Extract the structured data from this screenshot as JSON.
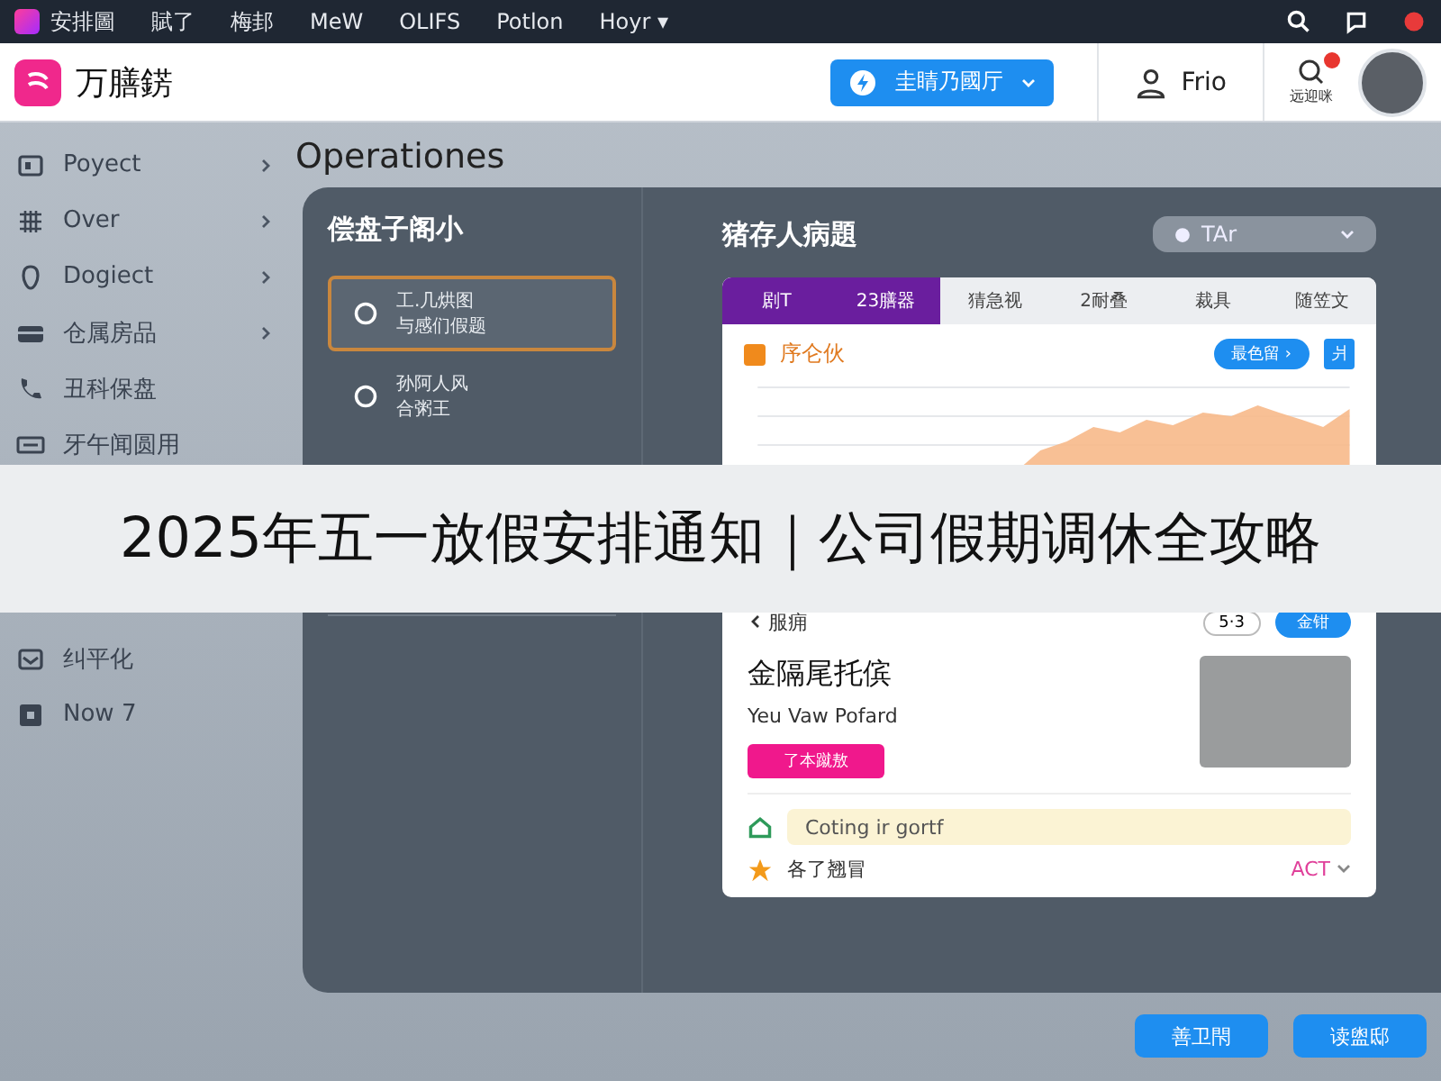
{
  "top_bar": {
    "brand": "安排圖",
    "menu": [
      "賦了",
      "梅邽",
      "MeW",
      "OLIFS",
      "Potlon",
      "Hoyr ▾"
    ]
  },
  "header": {
    "app_name": "万膳錺",
    "primary_button": "圭睛乃國厅",
    "user_label": "Frio",
    "notify_label": "远迎咪"
  },
  "sidebar": {
    "items": [
      {
        "label": "Poyect",
        "chevron": true
      },
      {
        "label": "Over",
        "chevron": true
      },
      {
        "label": "Dogiect",
        "chevron": true
      },
      {
        "label": "仓属房品",
        "chevron": true
      },
      {
        "label": "丑科保盘",
        "chevron": false
      },
      {
        "label": "牙午闻圆用",
        "chevron": false
      }
    ],
    "lower_items": [
      {
        "label": "纠平化",
        "chevron": false
      },
      {
        "label": "Now 7",
        "chevron": false
      }
    ]
  },
  "page_title": "Operationes",
  "list_panel": {
    "heading": "偿盘子阁小",
    "items": [
      {
        "lines": [
          "工.几烘图",
          "与感们假题"
        ],
        "selected": true
      },
      {
        "lines": [
          "孙阿人风",
          "合粥王"
        ],
        "selected": false
      }
    ]
  },
  "detail": {
    "heading": "猪存人病題",
    "dropdown": "TAr",
    "tabs": [
      {
        "label": "剧T",
        "selected": true
      },
      {
        "label": "23膳器",
        "selected": true
      },
      {
        "label": "猜急视",
        "selected": false
      },
      {
        "label": "2耐叠",
        "selected": false
      },
      {
        "label": "裁具",
        "selected": false
      },
      {
        "label": "随笠文",
        "selected": false
      }
    ],
    "chart_title": "序仑伙",
    "chart_button": "最色留 ›",
    "chart_badge": "爿"
  },
  "profile": {
    "back": "服痈",
    "pill": "5·3",
    "action": "金钳",
    "name": "金隔尾托傧",
    "subtitle": "Yeu Vaw Pofard",
    "tag": "了本蹴敖",
    "field_value": "Coting ir gortf",
    "footer_label": "各了翘冒",
    "status": "ACT"
  },
  "buttons": [
    "善卫閇",
    "读盥邸"
  ],
  "banner": "2025年五一放假安排通知｜公司假期调休全攻略"
}
